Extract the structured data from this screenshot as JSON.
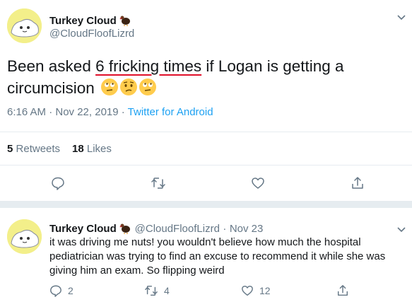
{
  "tweet": {
    "name": "Turkey Cloud",
    "handle": "@CloudFloofLizrd",
    "text_before": "Been asked ",
    "text_underlined": "6 fricking times",
    "text_after": " if Logan is getting a circumcision",
    "emojis": [
      "face-with-rolling-eyes",
      "confused-face",
      "face-with-rolling-eyes"
    ],
    "time": "6:16 AM · Nov 22, 2019",
    "separator": " · ",
    "source": "Twitter for Android",
    "retweets_count": "5",
    "retweets_label": "Retweets",
    "likes_count": "18",
    "likes_label": "Likes",
    "name_emoji": "turkey"
  },
  "reply": {
    "name": "Turkey Cloud",
    "handle": "@CloudFloofLizrd",
    "separator": "·",
    "date": "Nov 23",
    "text": "it was driving me nuts! you wouldn't believe how much the hospital pediatrician was trying to find an excuse to recommend it while she was giving him an exam. So flipping weird",
    "replies": "2",
    "retweets": "4",
    "likes": "12"
  },
  "colors": {
    "link": "#1da1f2",
    "secondary": "#657786",
    "underline": "#e0102a",
    "avatar_bg": "#f3ef8a"
  }
}
